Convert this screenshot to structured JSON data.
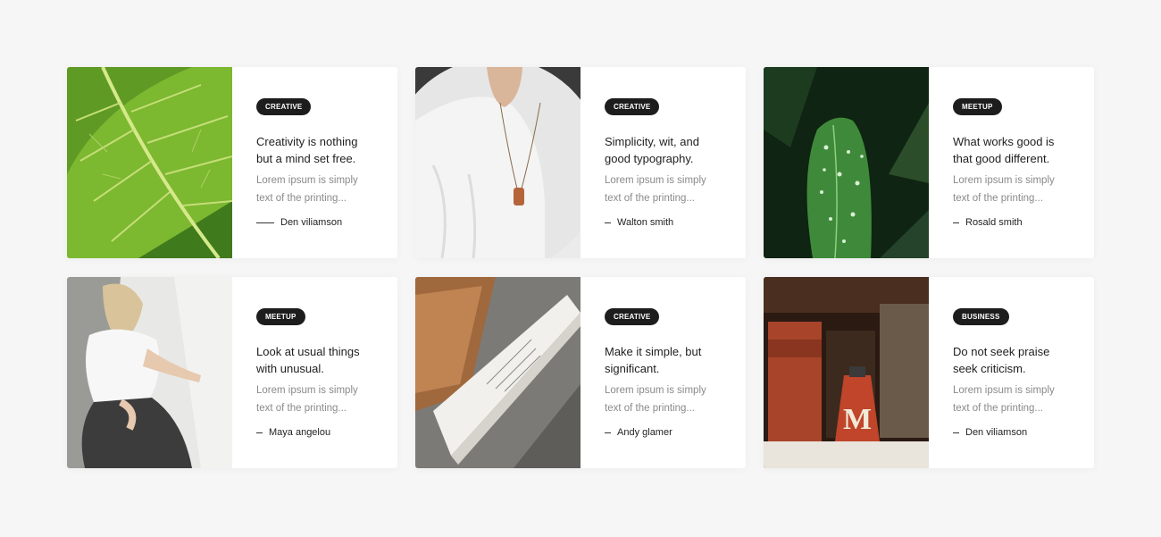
{
  "cards": [
    {
      "category": "CREATIVE",
      "title": "Creativity is nothing but a mind set free.",
      "excerpt": "Lorem ipsum is simply text of the printing...",
      "author": "Den viliamson",
      "image": "leaf-photo"
    },
    {
      "category": "CREATIVE",
      "title": "Simplicity, wit, and good typography.",
      "excerpt": "Lorem ipsum is simply text of the printing...",
      "author": "Walton smith",
      "image": "sweater-necklace-photo"
    },
    {
      "category": "MEETUP",
      "title": "What works good is that good different.",
      "excerpt": "Lorem ipsum is simply text of the printing...",
      "author": "Rosald smith",
      "image": "wet-plant-photo"
    },
    {
      "category": "MEETUP",
      "title": "Look at usual things with unusual.",
      "excerpt": "Lorem ipsum is simply text of the printing...",
      "author": "Maya angelou",
      "image": "woman-sitting-photo"
    },
    {
      "category": "CREATIVE",
      "title": "Make it simple, but significant.",
      "excerpt": "Lorem ipsum is simply text of the printing...",
      "author": "Andy glamer",
      "image": "notebook-photo"
    },
    {
      "category": "BUSINESS",
      "title": "Do not seek praise seek criticism.",
      "excerpt": "Lorem ipsum is simply text of the printing...",
      "author": "Den viliamson",
      "image": "red-bell-photo"
    }
  ]
}
